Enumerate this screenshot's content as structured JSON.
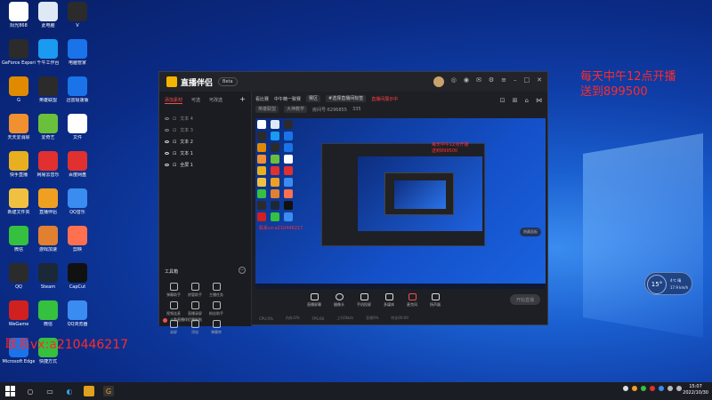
{
  "desktop_icons": [
    {
      "label": "阳光868",
      "color": "#ffffff"
    },
    {
      "label": "此电脑",
      "color": "#dfe8f5"
    },
    {
      "label": "V",
      "color": "#2b2b2b"
    },
    {
      "label": "GeForce Experience",
      "color": "#2b2b2b"
    },
    {
      "label": "千牛工作台",
      "color": "#1a9af0"
    },
    {
      "label": "电脑管家",
      "color": "#1a73e8"
    },
    {
      "label": "G",
      "color": "#e08a00"
    },
    {
      "label": "英雄联盟",
      "color": "#2b2b2b"
    },
    {
      "label": "迅雷极速版",
      "color": "#1a73e8"
    },
    {
      "label": "天天爱消除",
      "color": "#f09030"
    },
    {
      "label": "爱奇艺",
      "color": "#6ac03a"
    },
    {
      "label": "文件",
      "color": "#ffffff"
    },
    {
      "label": "快手直播",
      "color": "#e8b020"
    },
    {
      "label": "网易云音乐",
      "color": "#e03030"
    },
    {
      "label": "百度网盘",
      "color": "#e03030"
    },
    {
      "label": "新建文件夹",
      "color": "#f0c040"
    },
    {
      "label": "直播伴侣",
      "color": "#f0a020"
    },
    {
      "label": "QQ音乐",
      "color": "#3a8cf0"
    },
    {
      "label": "微信",
      "color": "#35c040"
    },
    {
      "label": "游戏加速",
      "color": "#e08030"
    },
    {
      "label": "剪映",
      "color": "#ff7050"
    },
    {
      "label": "QQ",
      "color": "#2b2b2b"
    },
    {
      "label": "Steam",
      "color": "#1b2838"
    },
    {
      "label": "CapCut",
      "color": "#111111"
    },
    {
      "label": "WeGame",
      "color": "#d02020"
    },
    {
      "label": "微信",
      "color": "#35c040"
    },
    {
      "label": "QQ浏览器",
      "color": "#3a8cf0"
    },
    {
      "label": "Microsoft Edge",
      "color": "#1a73e8"
    },
    {
      "label": "快捷方式",
      "color": "#35c040"
    }
  ],
  "overlay": {
    "schedule_line1": "每天中午12点开播",
    "schedule_line2": "送到899500",
    "contact": "联系vx:a210446217"
  },
  "app": {
    "title": "直播伴侣",
    "badge": "Beta",
    "left_tabs": [
      "添加素材",
      "可选",
      "可改选"
    ],
    "scenes": [
      {
        "name": "文本 4",
        "on": false
      },
      {
        "name": "文本 3",
        "on": false
      },
      {
        "name": "文本 2",
        "on": true
      },
      {
        "name": "文本 1",
        "on": true
      },
      {
        "name": "全屏 1",
        "on": true
      }
    ],
    "toolbox_title": "工具箱",
    "tools": [
      {
        "label": "弹幕助手"
      },
      {
        "label": "房管助手"
      },
      {
        "label": "主播任务"
      },
      {
        "label": ""
      },
      {
        "label": "视频连麦"
      },
      {
        "label": "直播录屏"
      },
      {
        "label": "粉丝助手"
      },
      {
        "label": ""
      },
      {
        "label": "录屏"
      },
      {
        "label": "添加"
      },
      {
        "label": "弹幕库"
      },
      {
        "label": ""
      }
    ],
    "left_footer": "斗鱼直播伴侣更新啦",
    "info_row1": {
      "channel": "看比赛",
      "subtitle": "中午精一致赛",
      "tag": "赛区",
      "notice": "#选择直播间标签",
      "red": "直播间展示中"
    },
    "info_row2": {
      "tag1": "英雄联盟",
      "tag2": "大神教学",
      "room": "房间号:6296855",
      "fans": "粉丝 6296855",
      "count": "335"
    },
    "preview_overlay": "每天中午12点开播\n送到899500",
    "preview_overlay2": "联系vx:a210446217",
    "controls": [
      "直播屏幕",
      "摄像头",
      "手机投屏",
      "多媒体",
      "麦克风",
      "扬声器"
    ],
    "start_button": "开始直播",
    "statusbar": [
      "CPU:0%",
      "内存:0%",
      "FPS:60",
      "上行0kb/s",
      "丢帧0%",
      "时长00:00"
    ]
  },
  "weather": {
    "temp": "15°",
    "line1": "4℃ 晴",
    "line2": "17.9 km/h"
  },
  "small_pill": "隐藏面板",
  "clock": {
    "time": "15:07",
    "date": "2022/10/30"
  },
  "taskbar_items": [
    "start",
    "search",
    "task-view",
    "edge",
    "file-explorer",
    "douyu"
  ],
  "colors": {
    "accent": "#f05050",
    "overlay_red": "#ff2a2a"
  }
}
